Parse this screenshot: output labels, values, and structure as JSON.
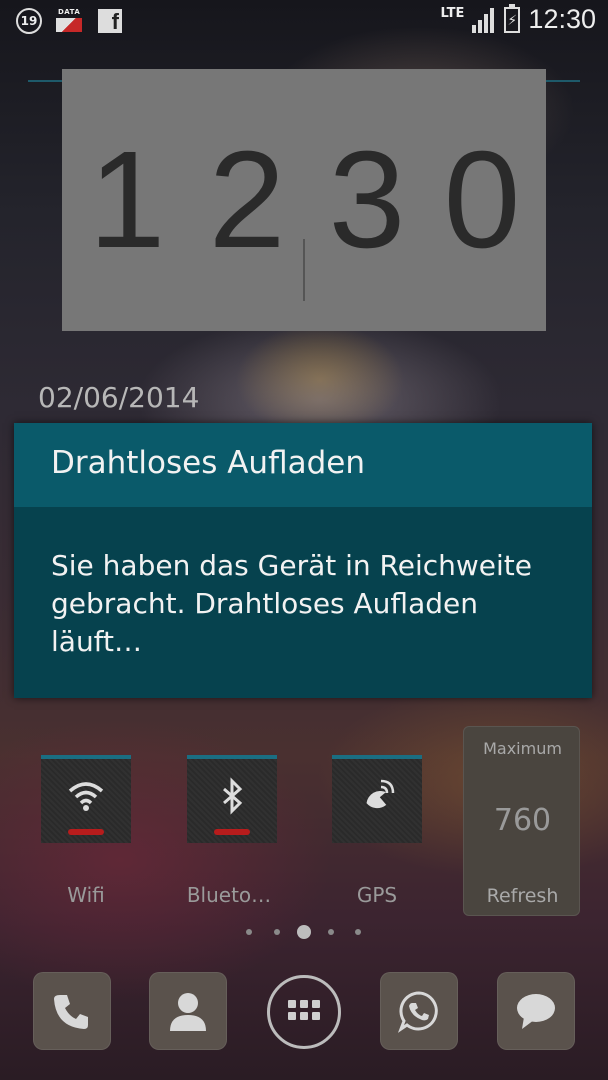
{
  "status_bar": {
    "notification_count": "19",
    "data_label": "DATA",
    "facebook_glyph": "f",
    "network_type": "LTE",
    "time": "12:30"
  },
  "clock_widget": {
    "hour_tens": "1",
    "hour_ones": "2",
    "minute_tens": "3",
    "minute_ones": "0"
  },
  "date": "02/06/2014",
  "dialog": {
    "title": "Drahtloses Aufladen",
    "message_line1": "Sie haben das Gerät in Reichweite",
    "message_line2": "gebracht. Drahtloses Aufladen",
    "message_line3": "läuft…"
  },
  "toggles": [
    {
      "label": "Wifi",
      "icon": "wifi-icon",
      "state": "off"
    },
    {
      "label": "Blueto…",
      "icon": "bluetooth-icon",
      "state": "off"
    },
    {
      "label": "GPS",
      "icon": "gps-icon",
      "state": "off"
    }
  ],
  "refresh_widget": {
    "top_label": "Maximum",
    "value": "760",
    "bottom_label": "Refresh"
  },
  "page_indicator": {
    "pages": 5,
    "current": 3
  },
  "dock": [
    {
      "icon": "phone-icon"
    },
    {
      "icon": "contacts-icon"
    },
    {
      "icon": "apps-grid-icon"
    },
    {
      "icon": "whatsapp-icon"
    },
    {
      "icon": "messaging-icon"
    }
  ],
  "colors": {
    "dialog_title_bg": "#0a5a6a",
    "dialog_body_bg": "#06424e",
    "toggle_off_indicator": "#b71c1c",
    "toggle_accent": "#1a6e82"
  }
}
